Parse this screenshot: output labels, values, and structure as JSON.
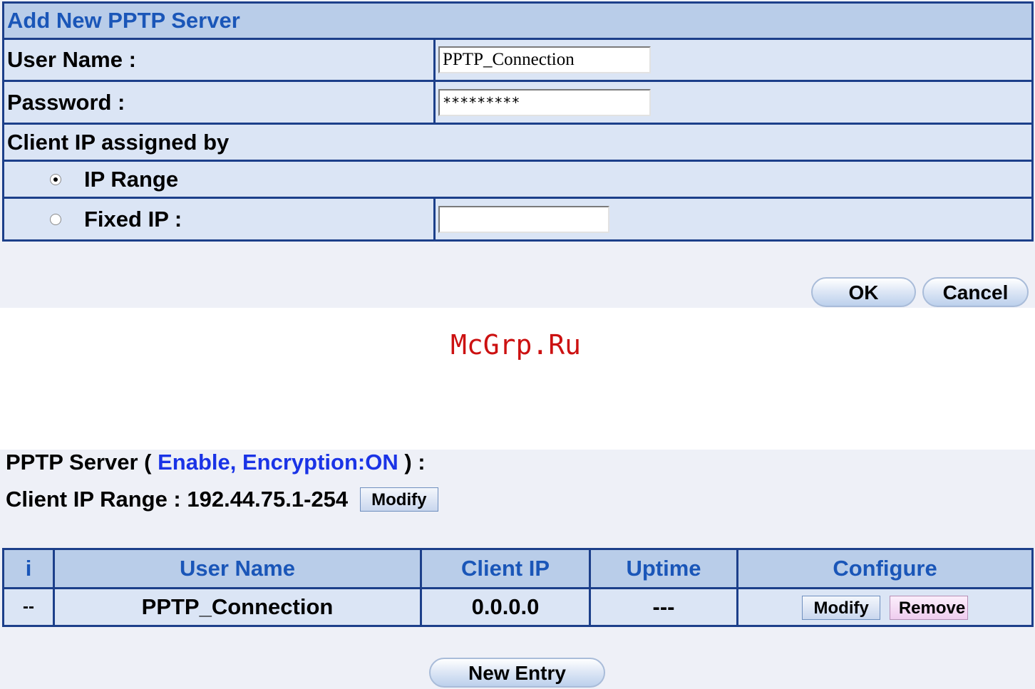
{
  "form": {
    "title": "Add New PPTP Server",
    "user_name_label": "User Name  :",
    "user_name_value": "PPTP_Connection",
    "password_label": "Password  :",
    "password_value": "*********",
    "client_ip_label": "Client IP assigned by",
    "ip_range_label": "IP Range",
    "fixed_ip_label": "Fixed IP :",
    "fixed_ip_value": "",
    "selected_option": "IP Range",
    "ok_label": "OK",
    "cancel_label": "Cancel"
  },
  "watermark": "McGrp.Ru",
  "server": {
    "prefix": "PPTP Server ( ",
    "status": "Enable, Encryption:ON",
    "suffix": " ) :",
    "range_label": "Client IP Range : 192.44.75.1-254",
    "modify_label": "Modify"
  },
  "table": {
    "headers": [
      "i",
      "User Name",
      "Client IP",
      "Uptime",
      "Configure"
    ],
    "rows": [
      {
        "index": "--",
        "user_name": "PPTP_Connection",
        "client_ip": "0.0.0.0",
        "uptime": "---",
        "modify_label": "Modify",
        "remove_label": "Remove"
      }
    ]
  },
  "new_entry_label": "New Entry",
  "colors": {
    "header_text": "#1a56b8",
    "status_text": "#1a33e6",
    "border": "#1c3f8a",
    "watermark": "#cc1111"
  }
}
